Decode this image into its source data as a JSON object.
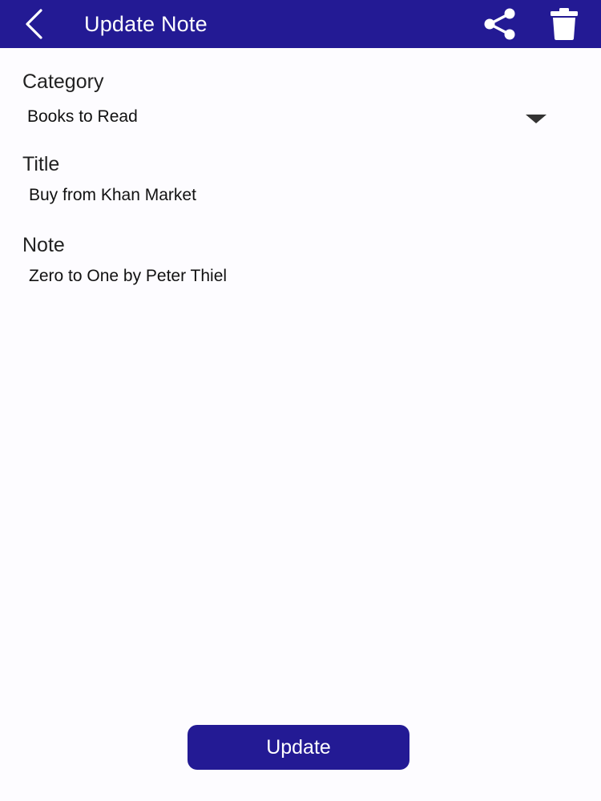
{
  "header": {
    "title": "Update Note",
    "back_icon": "chevron-left-icon",
    "share_icon": "share-icon",
    "delete_icon": "trash-icon",
    "background_color": "#231a94"
  },
  "form": {
    "category": {
      "label": "Category",
      "selected": "Books to Read",
      "icon": "caret-down-icon"
    },
    "title": {
      "label": "Title",
      "value": "Buy from Khan Market"
    },
    "note": {
      "label": "Note",
      "value": "Zero to One by Peter Thiel"
    }
  },
  "actions": {
    "update_label": "Update",
    "button_color": "#231a94"
  }
}
